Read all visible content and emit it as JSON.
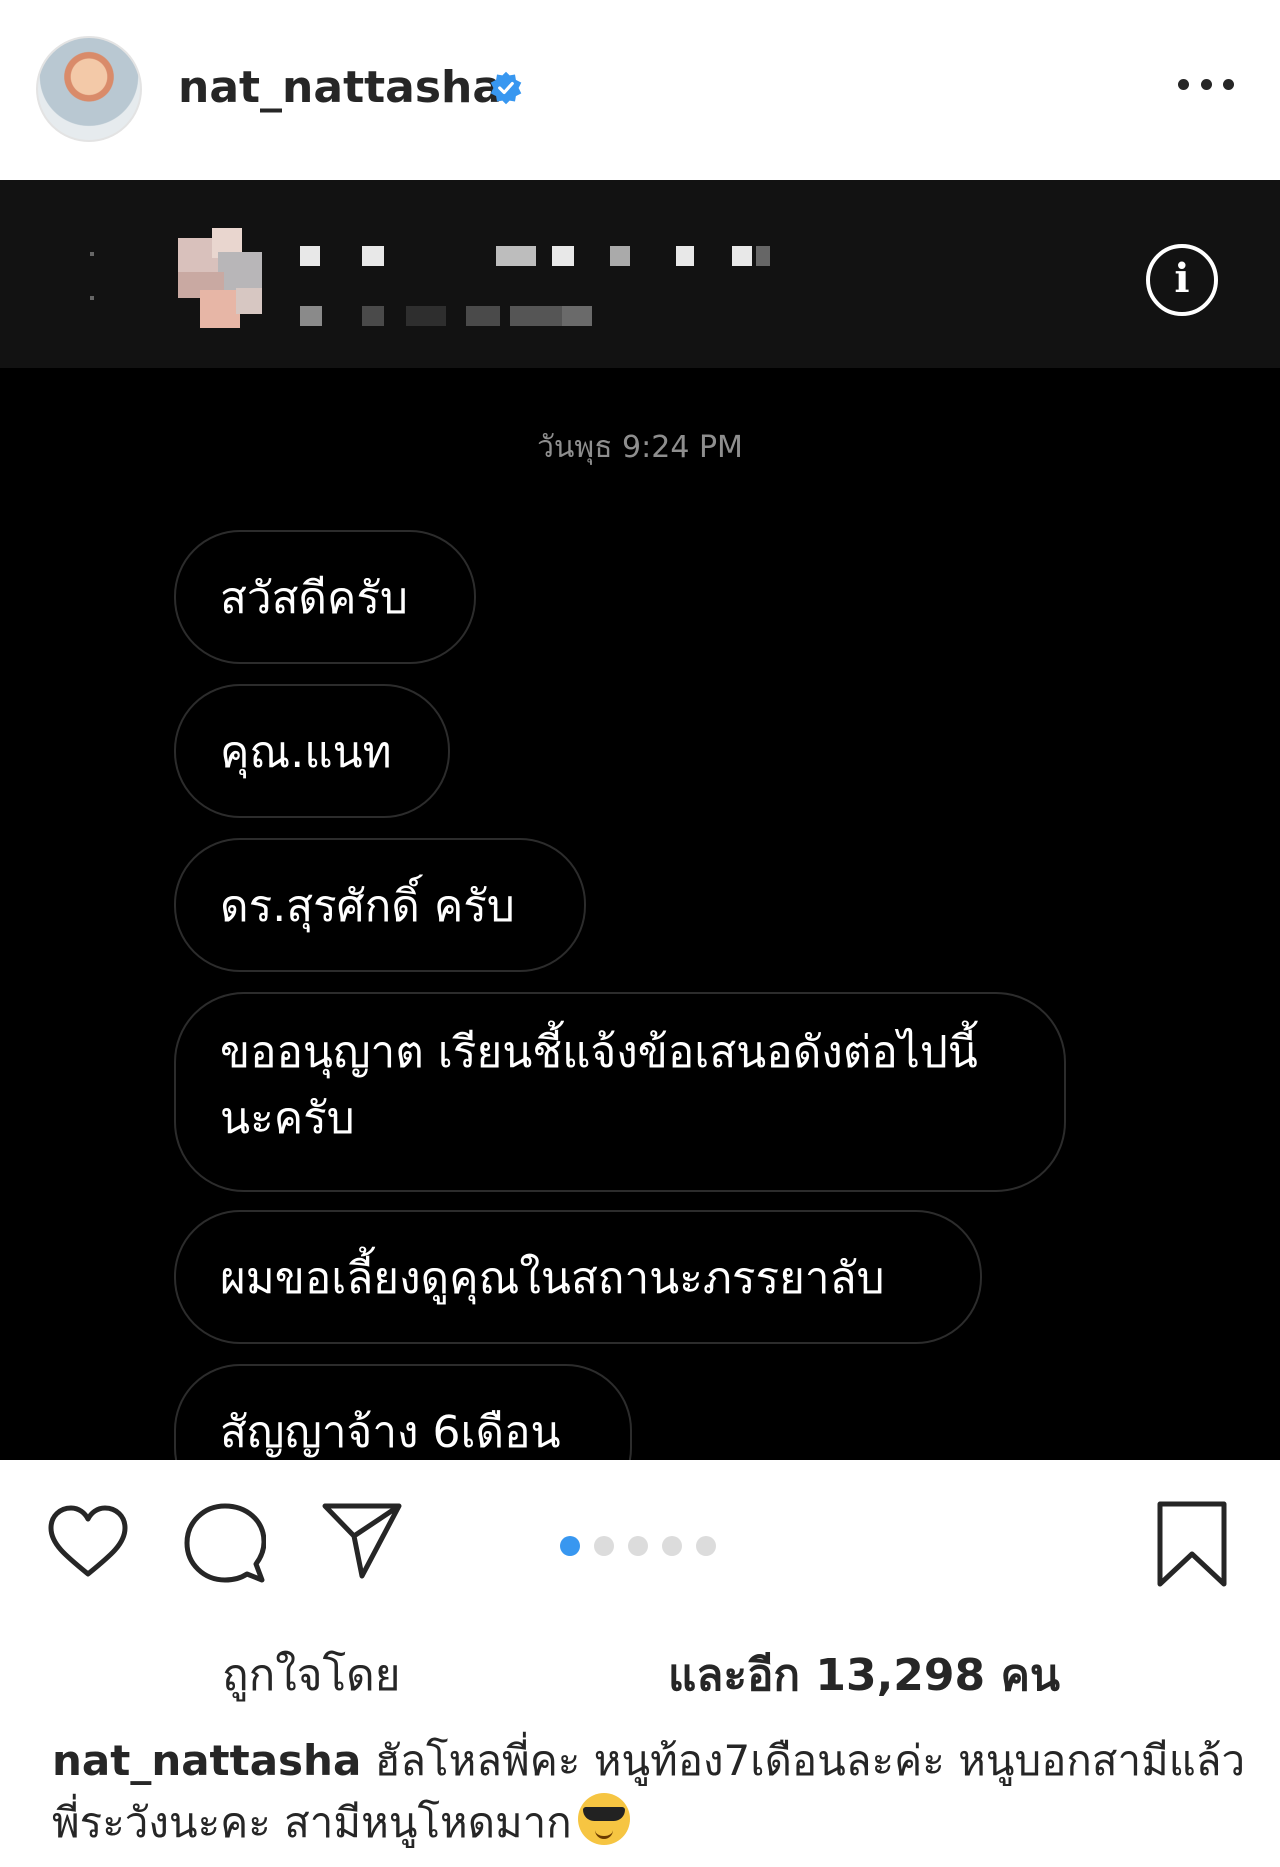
{
  "post": {
    "username": "nat_nattasha",
    "verified": true,
    "more_icon": "more-horizontal-icon"
  },
  "dm": {
    "timestamp": "วันพุธ 9:24 PM",
    "info_icon_glyph": "i",
    "messages": [
      "สวัสดีครับ",
      "คุณ.แนท",
      "ดร.สุรศักดิ์ ครับ",
      "ขออนุญาต เรียนชี้แจ้งข้อเสนอดังต่อไปนี้ นะครับ",
      "ผมขอเลี้ยงดูคุณในสถานะภรรยาลับ",
      "สัญญาจ้าง 6เดือน"
    ]
  },
  "actions": {
    "carousel_count": 5,
    "carousel_active": 1,
    "colors": {
      "active_dot": "#3897f0",
      "inactive_dot": "#dcdcdc"
    }
  },
  "likes": {
    "prefix": "ถูกใจโดย",
    "suffix": "และอีก 13,298 คน"
  },
  "caption": {
    "username": "nat_nattasha",
    "text": " ฮัลโหลพี่คะ หนูท้อง7เดือนละค่ะ  หนูบอกสามีแล้ว พี่ระวังนะคะ สามีหนูโหดมาก",
    "emoji": "smiling-face-with-sunglasses-emoji"
  }
}
